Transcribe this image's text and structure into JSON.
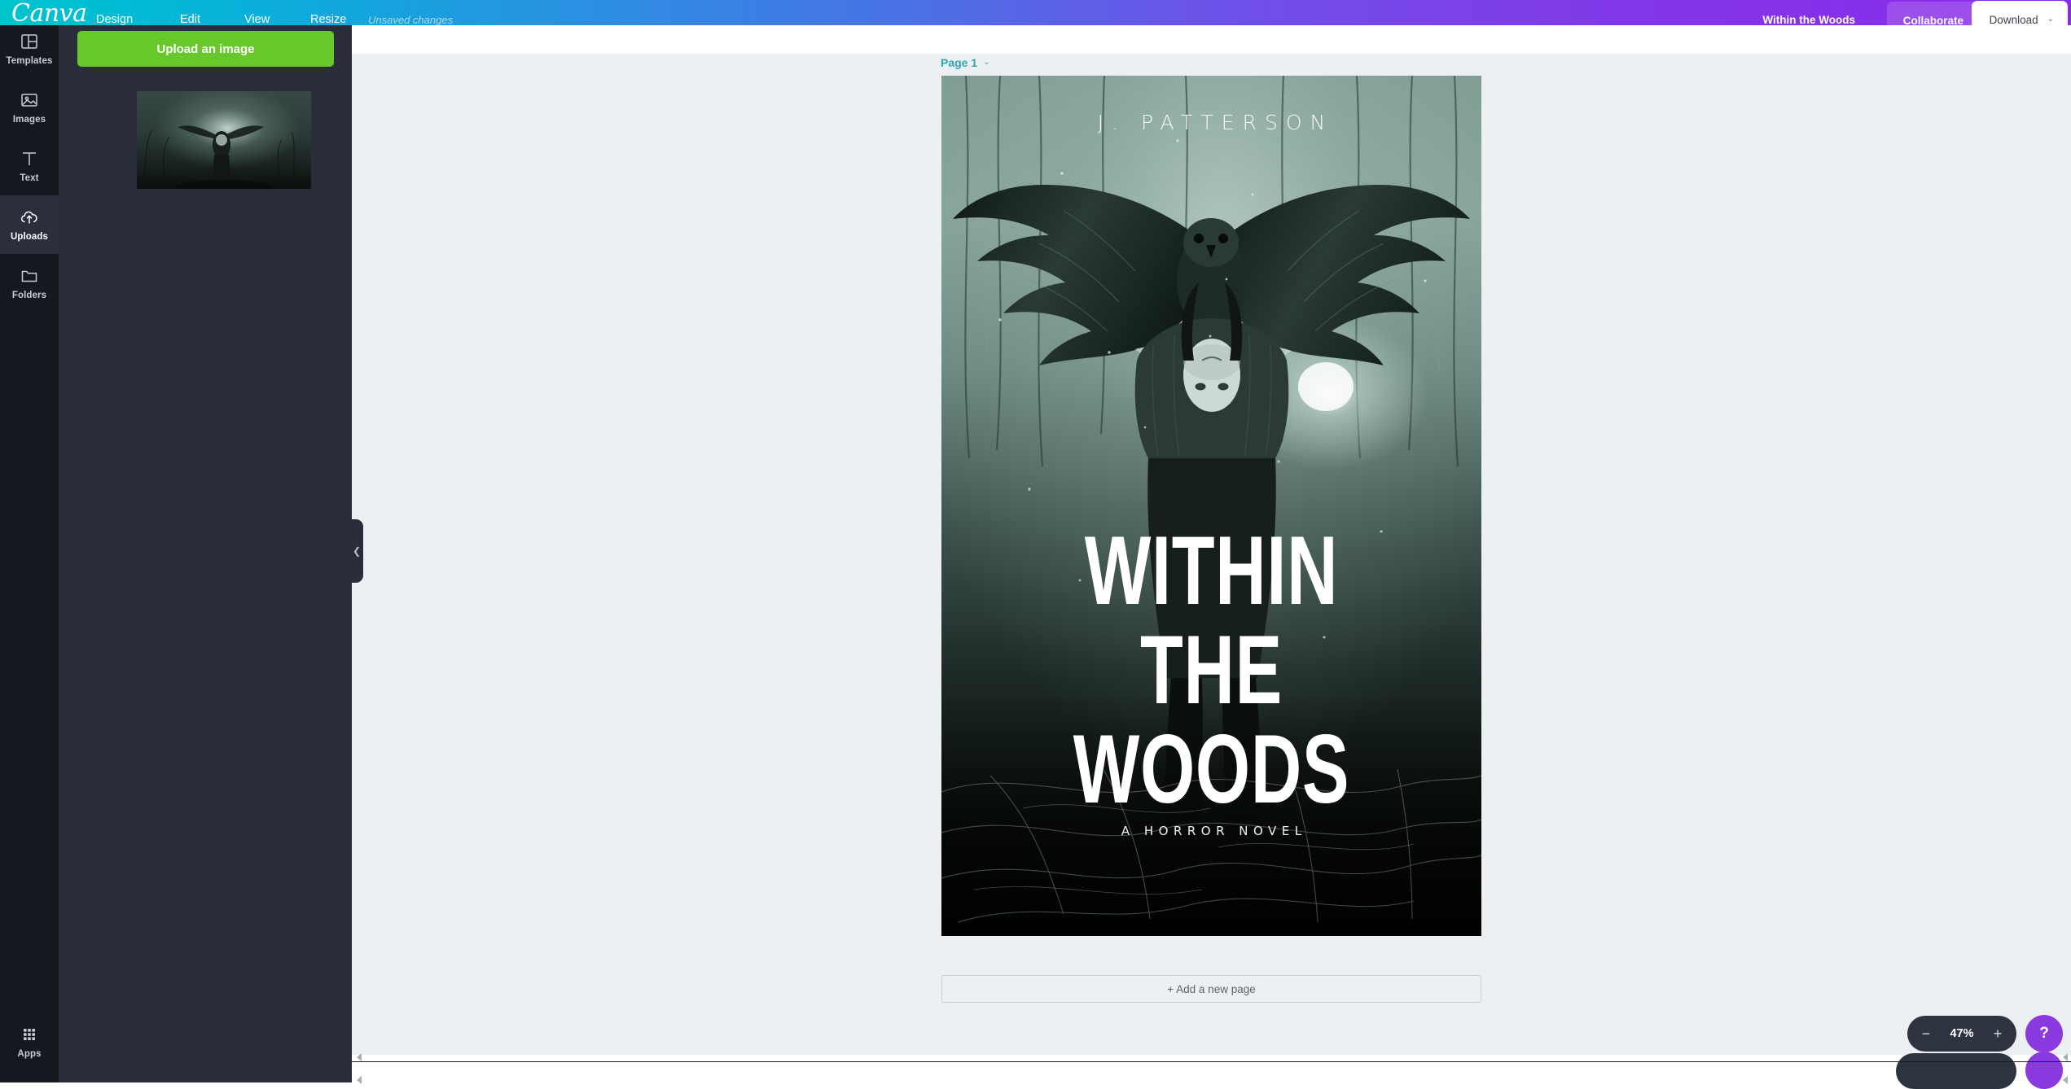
{
  "header": {
    "logo": "Canva",
    "menu": [
      {
        "label": "Design"
      },
      {
        "label": "Edit"
      },
      {
        "label": "View"
      },
      {
        "label": "Resize"
      }
    ],
    "status": "Unsaved changes",
    "doc_title": "Within the Woods",
    "collaborate_label": "Collaborate",
    "download_label": "Download",
    "download_caret": "⌄",
    "gradient_start": "#00c4cc",
    "gradient_end": "#8b2be9"
  },
  "rail": {
    "items": [
      {
        "label": "Templates",
        "icon": "templates-icon",
        "active": false
      },
      {
        "label": "Images",
        "icon": "images-icon",
        "active": false
      },
      {
        "label": "Text",
        "icon": "text-icon",
        "active": false
      },
      {
        "label": "Uploads",
        "icon": "uploads-icon",
        "active": true
      },
      {
        "label": "Folders",
        "icon": "folders-icon",
        "active": false
      }
    ],
    "bottom": {
      "label": "Apps",
      "icon": "apps-grid-icon"
    },
    "bottom_duplicate": "Apps"
  },
  "panel": {
    "upload_button": "Upload an image",
    "thumbnail_name": "uploaded-cover-image"
  },
  "canvas": {
    "page_label": "Page 1",
    "page_caret": "⌄",
    "add_page_label": "+ Add a new page",
    "background": "#edf0f2",
    "page_label_color": "#2aa5b5"
  },
  "cover": {
    "author": "J. PATTERSON",
    "title_lines": [
      "WITHIN",
      "THE",
      "WOODS"
    ],
    "subtitle": "A HORROR NOVEL",
    "scene": "dark misty forest with owl in flight and figure"
  },
  "zoom": {
    "minus": "−",
    "value": "47%",
    "plus": "+"
  },
  "help": {
    "label": "?"
  }
}
